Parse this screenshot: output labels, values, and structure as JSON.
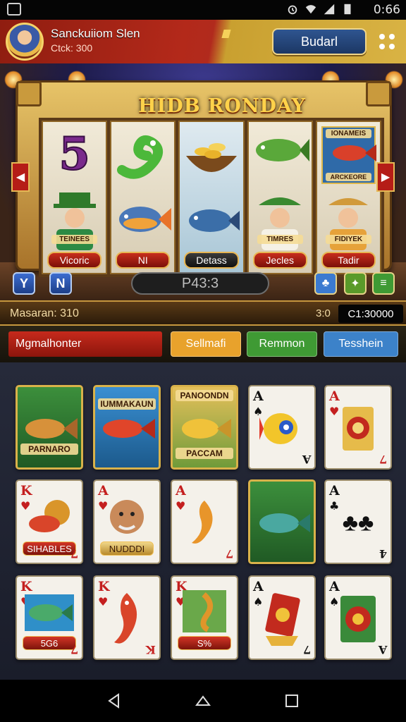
{
  "status_bar": {
    "time": "0:66"
  },
  "header": {
    "player_name": "Sanckuiiom Slen",
    "player_sub": "Ctck: 300",
    "top_button": "Budarl"
  },
  "slot": {
    "title": "HIDB RONDAY",
    "reels": [
      {
        "top": "5",
        "label": "Vicoric"
      },
      {
        "top": "serpent",
        "label": "NI"
      },
      {
        "top": "coins",
        "label": "Detass"
      },
      {
        "top": "fish",
        "label": "Jecles"
      },
      {
        "top_card": "IONAMEIS",
        "top_card_sub": "ARCKEORE",
        "label": "Tadir"
      }
    ],
    "left_button_1": "Y",
    "left_button_2": "N",
    "spin_display": "P43:3",
    "character_badges": [
      "TEINEES",
      "TIMRES",
      "FIDIYEK"
    ]
  },
  "info_bar": {
    "left": "Masaran: 310",
    "mid": "3:0",
    "credit": "C1:30000"
  },
  "filters": {
    "main": "Mgmalhonter",
    "buttons": [
      {
        "label": "Sellmafi",
        "color": "#e8a22c"
      },
      {
        "label": "Remmon",
        "color": "#3f9a34"
      },
      {
        "label": "Tesshein",
        "color": "#3c82c9"
      }
    ]
  },
  "cards": [
    {
      "kind": "scene",
      "title_bottom": "PARNARO"
    },
    {
      "kind": "scene",
      "title_top": "IUMMAKAUN"
    },
    {
      "kind": "scene",
      "title_top": "PANOONDN",
      "title_bottom": "PACCAM"
    },
    {
      "kind": "rank",
      "rank": "A",
      "suit": "♠",
      "rank_b": "A"
    },
    {
      "kind": "rank",
      "rank": "A",
      "suit": "♥",
      "rank_b": "7"
    },
    {
      "kind": "rank",
      "rank": "K",
      "suit": "♥",
      "label": "SIHABLES",
      "rank_b": "7"
    },
    {
      "kind": "rank",
      "rank": "A",
      "suit": "♥",
      "label": "NUDDDI"
    },
    {
      "kind": "rank",
      "rank": "A",
      "suit": "♥",
      "rank_b": "7"
    },
    {
      "kind": "scene",
      "title_top": ""
    },
    {
      "kind": "rank",
      "rank": "A",
      "suit": "♣",
      "rank_b": "4"
    },
    {
      "kind": "rank",
      "rank": "K",
      "suit": "♥",
      "label": "5G6",
      "rank_b": "7"
    },
    {
      "kind": "rank",
      "rank": "K",
      "suit": "♥",
      "rank_b": "K"
    },
    {
      "kind": "rank",
      "rank": "K",
      "suit": "♥",
      "label": "S%"
    },
    {
      "kind": "rank",
      "rank": "A",
      "suit": "♠",
      "rank_b": "7"
    },
    {
      "kind": "rank",
      "rank": "A",
      "suit": "♠",
      "rank_b": "A"
    }
  ]
}
